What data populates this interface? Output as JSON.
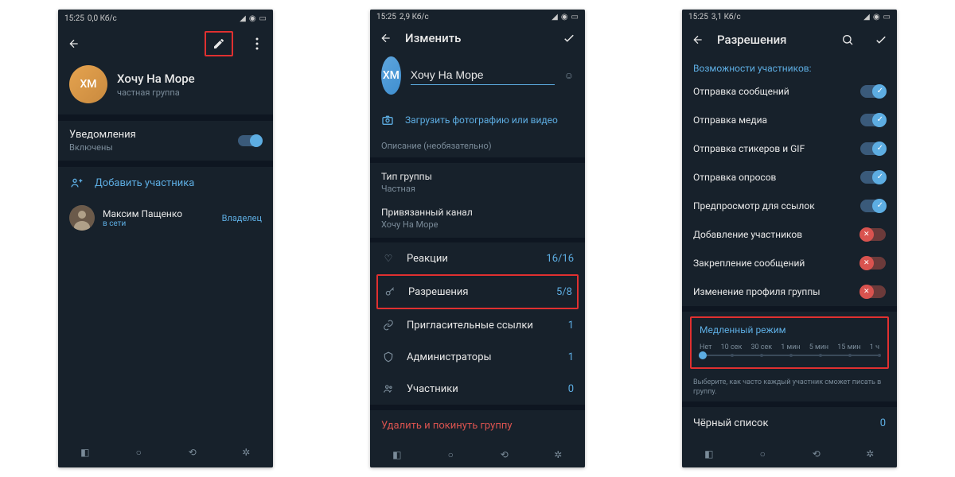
{
  "status": {
    "time": "15:25",
    "net1": "0,0 Кб/с",
    "net2": "2,9 Кб/с",
    "net3": "3,1 Кб/с"
  },
  "screen1": {
    "group_initials": "ХМ",
    "group_name": "Хочу На Море",
    "group_type": "частная группа",
    "notif_label": "Уведомления",
    "notif_sub": "Включены",
    "add_label": "Добавить участника",
    "member_name": "Максим Пащенко",
    "member_status": "в сети",
    "member_role": "Владелец"
  },
  "screen2": {
    "title": "Изменить",
    "group_initials": "ХМ",
    "group_name_input": "Хочу На Море",
    "upload_label": "Загрузить фотографию или видео",
    "desc_placeholder": "Описание (необязательно)",
    "type_label": "Тип группы",
    "type_value": "Частная",
    "linked_label": "Привязанный канал",
    "linked_value": "Хочу На Море",
    "reactions_label": "Реакции",
    "reactions_value": "16/16",
    "permissions_label": "Разрешения",
    "permissions_value": "5/8",
    "invite_label": "Пригласительные ссылки",
    "invite_value": "1",
    "admins_label": "Администраторы",
    "admins_value": "1",
    "members_label": "Участники",
    "members_value": "0",
    "delete_label": "Удалить и покинуть группу"
  },
  "screen3": {
    "title": "Разрешения",
    "section": "Возможности участников:",
    "perms": [
      {
        "label": "Отправка сообщений",
        "on": true
      },
      {
        "label": "Отправка медиа",
        "on": true
      },
      {
        "label": "Отправка стикеров и GIF",
        "on": true
      },
      {
        "label": "Отправка опросов",
        "on": true
      },
      {
        "label": "Предпросмотр для ссылок",
        "on": true
      },
      {
        "label": "Добавление участников",
        "on": false
      },
      {
        "label": "Закрепление сообщений",
        "on": false
      },
      {
        "label": "Изменение профиля группы",
        "on": false
      }
    ],
    "slow_title": "Медленный режим",
    "slow_labels": [
      "Нет",
      "10 сек",
      "30 сек",
      "1 мин",
      "5 мин",
      "15 мин",
      "1 ч"
    ],
    "slow_desc": "Выберите, как часто каждый участник сможет писать в группу.",
    "blacklist_label": "Чёрный список",
    "blacklist_value": "0"
  }
}
